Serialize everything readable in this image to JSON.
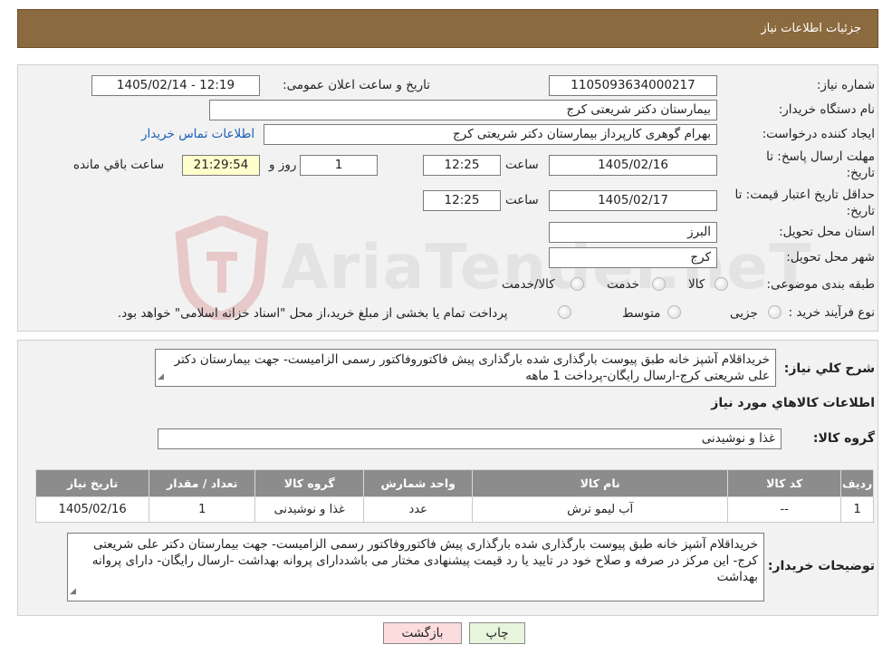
{
  "header": {
    "title": "جزئیات اطلاعات نیاز"
  },
  "fields": {
    "need_number_label": "شماره نیاز:",
    "need_number": "1105093634000217",
    "announce_label": "تاریخ و ساعت اعلان عمومی:",
    "announce_value": "1405/02/14 - 12:19",
    "buyer_org_label": "نام دستگاه خریدار:",
    "buyer_org": "بیمارستان دکتر شریعتی کرج",
    "requester_label": "ایجاد کننده درخواست:",
    "requester": "بهرام گوهری کارپرداز بیمارستان دکتر شریعتی کرج",
    "contact_link": "اطلاعات تماس خریدار",
    "deadline_label_1": "مهلت ارسال پاسخ: تا",
    "deadline_label_2": "تاریخ:",
    "deadline_date": "1405/02/16",
    "time_label": "ساعت",
    "deadline_time": "12:25",
    "days_value": "1",
    "days_label": "روز و",
    "remaining_time": "21:29:54",
    "remaining_label": "ساعت باقي مانده",
    "validity_label_1": "حداقل تاریخ اعتبار قیمت: تا",
    "validity_label_2": "تاریخ:",
    "validity_date": "1405/02/17",
    "validity_time": "12:25",
    "province_label": "استان محل تحویل:",
    "province": "البرز",
    "city_label": "شهر محل تحویل:",
    "city": "کرج",
    "category_label": "طبقه بندی موضوعی:",
    "category_options": [
      "کالا",
      "خدمت",
      "کالا/خدمت"
    ],
    "process_label": "نوع فرآیند خرید :",
    "process_options": [
      "جزیی",
      "متوسط"
    ],
    "process_note": "پرداخت تمام یا بخشی از مبلغ خرید،از محل \"اسناد خزانه اسلامی\" خواهد بود."
  },
  "watermark": {
    "text": "AriaTender.neT"
  },
  "general": {
    "label": "شرح کلي نياز:",
    "text": "خریداقلام آشپز خانه طبق پیوست بارگذاری شده بارگذاری پیش فاکتوروفاکتور رسمی الزامیست- جهت بیمارستان دکتر علی شریعتی کرج-ارسال رایگان-پرداخت 1 ماهه"
  },
  "goods": {
    "section_title": "اطلاعات کالاهاي مورد نياز",
    "group_label": "گروه کالا:",
    "group_value": "غذا و نوشیدنی",
    "columns": [
      "ردیف",
      "کد کالا",
      "نام کالا",
      "واحد شمارش",
      "گروه کالا",
      "تعداد / مقدار",
      "تاریخ نیاز"
    ],
    "rows": [
      [
        "1",
        "--",
        "آب لیمو ترش",
        "عدد",
        "غذا و نوشیدنی",
        "1",
        "1405/02/16"
      ]
    ]
  },
  "buyer_notes": {
    "label": "توضیحات خریدار:",
    "text": "خریداقلام آشپز خانه طبق پیوست بارگذاری شده بارگذاری پیش فاکتوروفاکتور رسمی الزامیست- جهت بیمارستان دکتر علی شریعتی کرج- این مرکز در صرفه و صلاح خود در تایید یا رد قیمت پیشنهادی مختار می باشددارای پروانه بهداشت -ارسال رایگان- دارای پروانه بهداشت"
  },
  "buttons": {
    "print": "چاپ",
    "back": "بازگشت"
  }
}
